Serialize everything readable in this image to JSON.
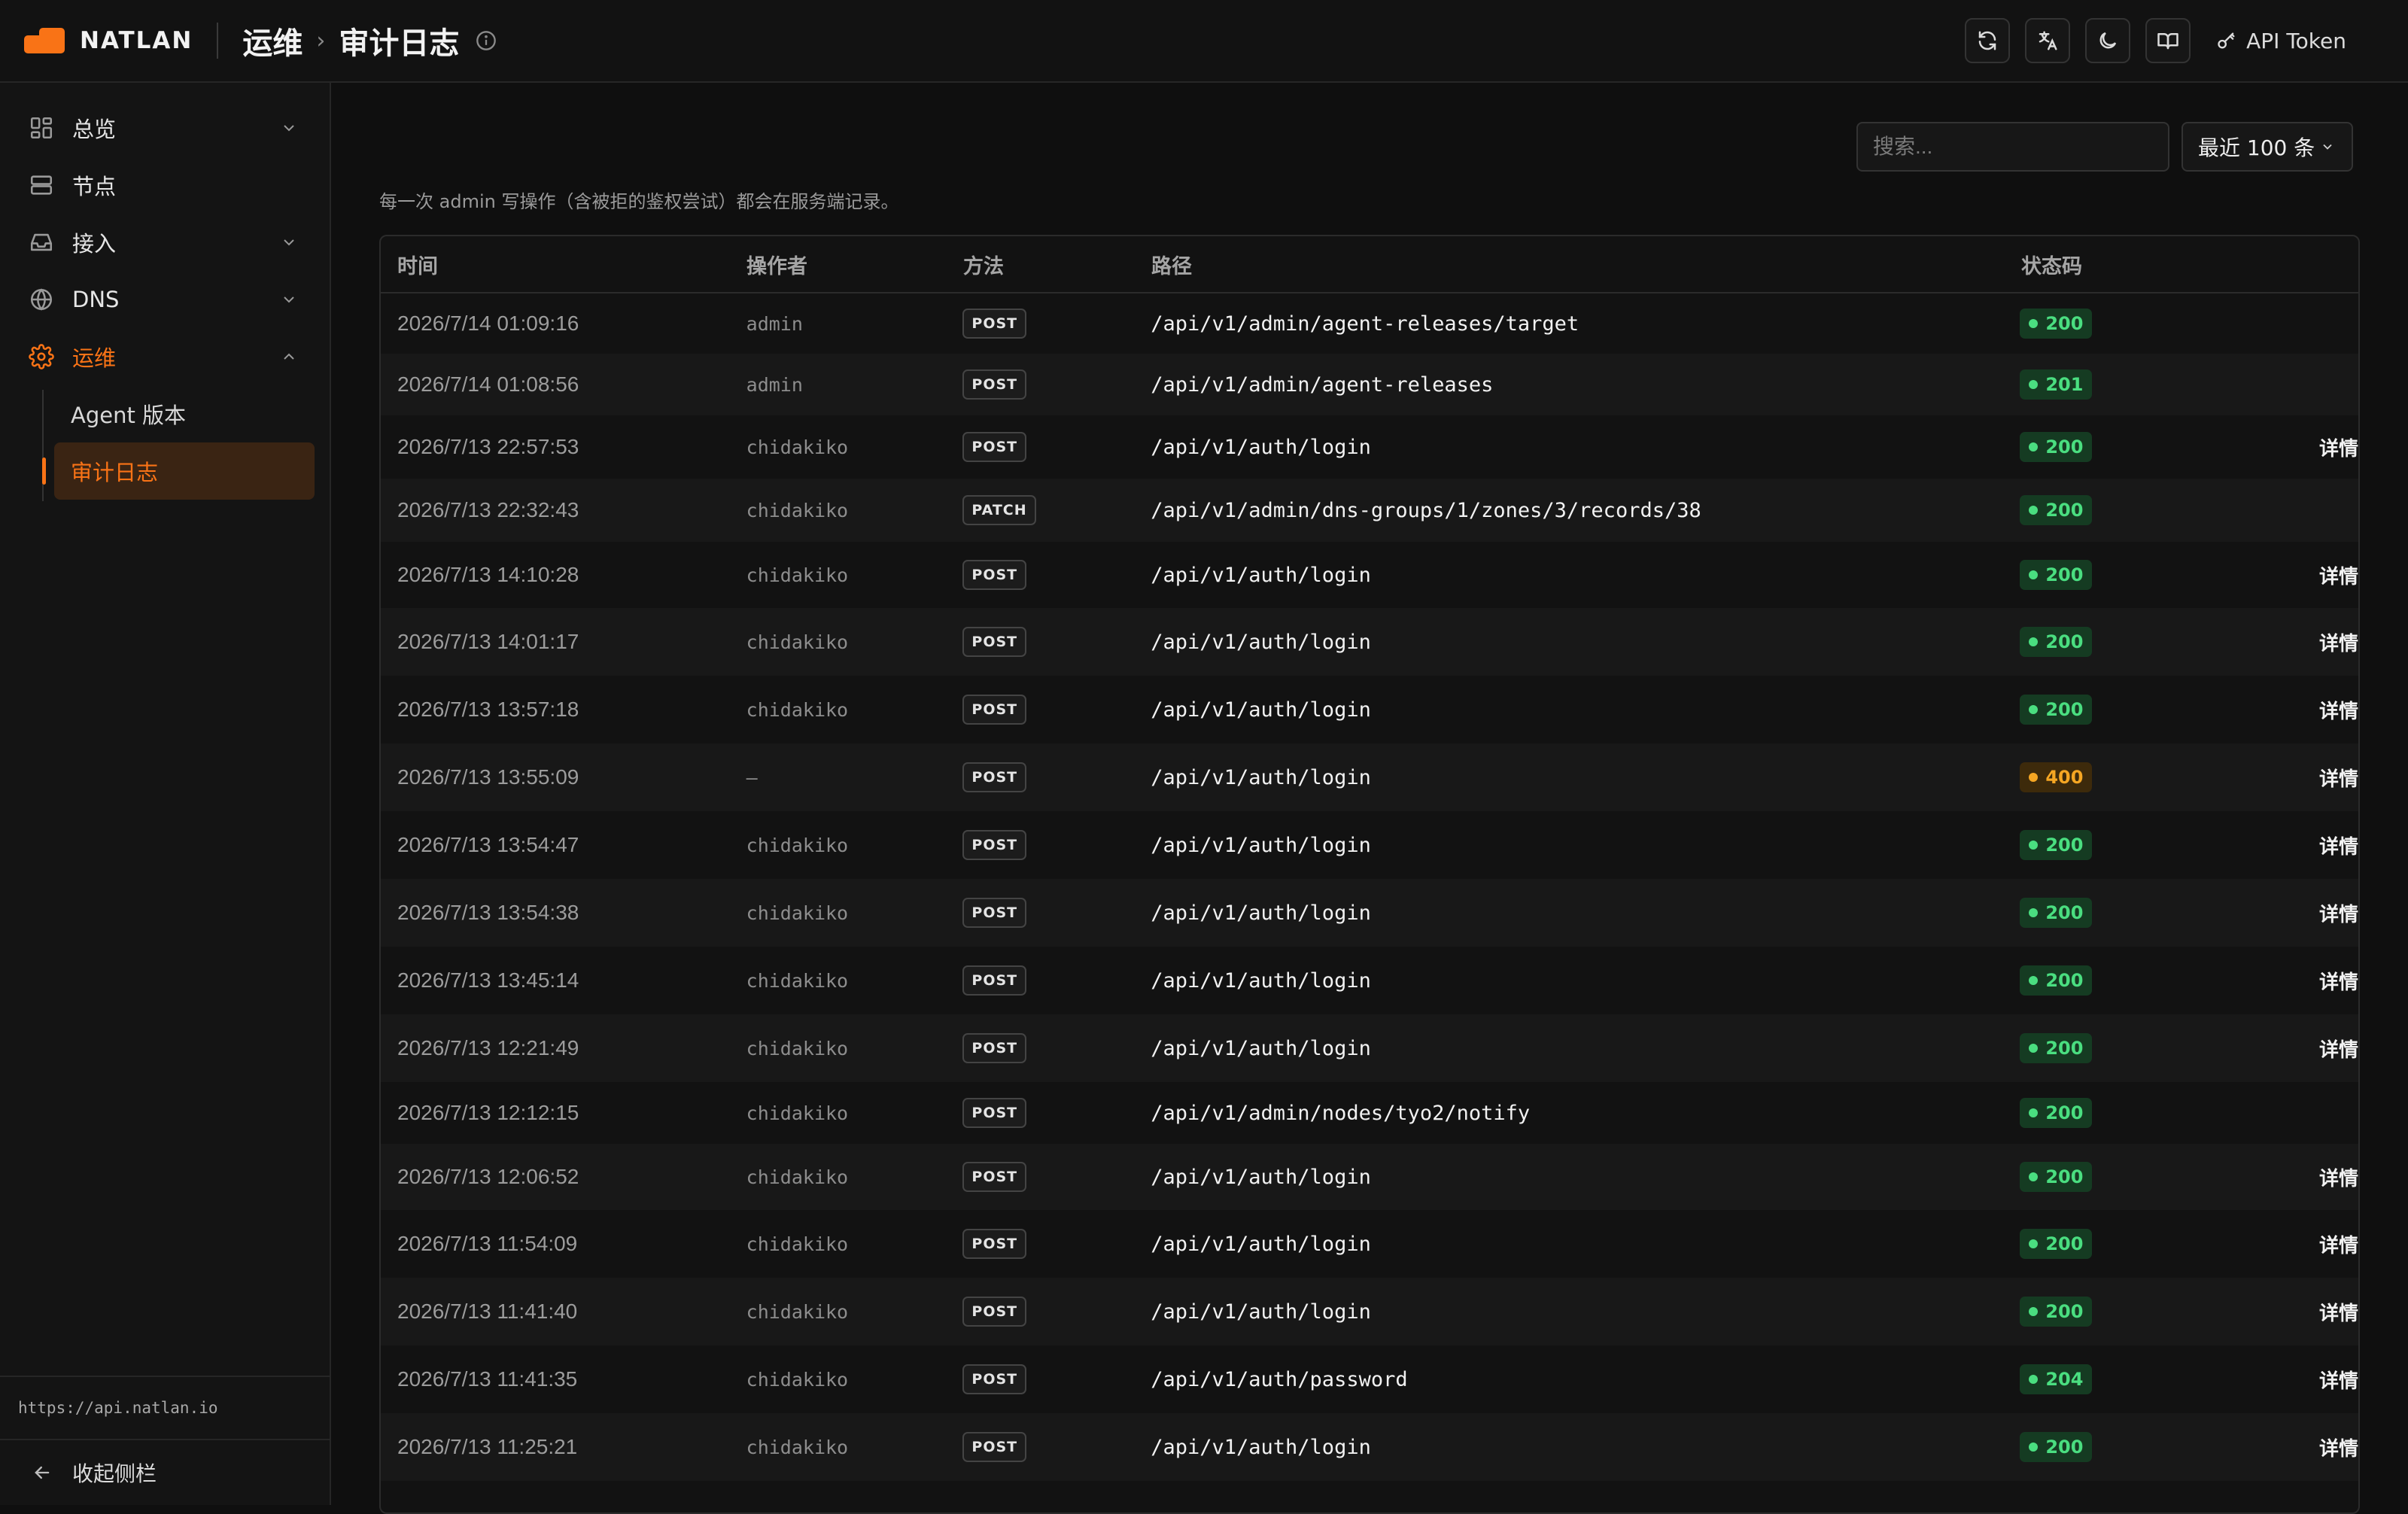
{
  "brand": {
    "name": "NATLAN"
  },
  "breadcrumb": {
    "section": "运维",
    "page": "审计日志"
  },
  "topbar": {
    "token_label": "API Token"
  },
  "sidebar": {
    "items": [
      {
        "label": "总览",
        "icon": "dashboard-icon",
        "expandable": true,
        "expanded": false
      },
      {
        "label": "节点",
        "icon": "server-icon",
        "expandable": false
      },
      {
        "label": "接入",
        "icon": "inbox-icon",
        "expandable": true,
        "expanded": false
      },
      {
        "label": "DNS",
        "icon": "globe-icon",
        "expandable": true,
        "expanded": false
      },
      {
        "label": "运维",
        "icon": "gear-icon",
        "expandable": true,
        "expanded": true,
        "active": true
      }
    ],
    "sub_items": [
      {
        "label": "Agent 版本"
      },
      {
        "label": "审计日志",
        "active": true
      }
    ],
    "api_url": "https://api.natlan.io",
    "collapse_label": "收起侧栏"
  },
  "controls": {
    "search_placeholder": "搜索...",
    "range_label": "最近 100 条"
  },
  "description": "每一次 admin 写操作（含被拒的鉴权尝试）都会在服务端记录。",
  "table": {
    "headers": {
      "time": "时间",
      "operator": "操作者",
      "method": "方法",
      "path": "路径",
      "status": "状态码"
    },
    "detail_label": "详情",
    "rows": [
      {
        "time": "2026/7/14 01:09:16",
        "operator": "admin",
        "method": "POST",
        "path": "/api/v1/admin/agent-releases/target",
        "status": "200",
        "level": "ok",
        "detail": ""
      },
      {
        "time": "2026/7/14 01:08:56",
        "operator": "admin",
        "method": "POST",
        "path": "/api/v1/admin/agent-releases",
        "status": "201",
        "level": "ok",
        "detail": ""
      },
      {
        "time": "2026/7/13 22:57:53",
        "operator": "chidakiko",
        "method": "POST",
        "path": "/api/v1/auth/login",
        "status": "200",
        "level": "ok",
        "detail": "详情"
      },
      {
        "time": "2026/7/13 22:32:43",
        "operator": "chidakiko",
        "method": "PATCH",
        "path": "/api/v1/admin/dns-groups/1/zones/3/records/38",
        "status": "200",
        "level": "ok",
        "detail": ""
      },
      {
        "time": "2026/7/13 14:10:28",
        "operator": "chidakiko",
        "method": "POST",
        "path": "/api/v1/auth/login",
        "status": "200",
        "level": "ok",
        "detail": "详情"
      },
      {
        "time": "2026/7/13 14:01:17",
        "operator": "chidakiko",
        "method": "POST",
        "path": "/api/v1/auth/login",
        "status": "200",
        "level": "ok",
        "detail": "详情"
      },
      {
        "time": "2026/7/13 13:57:18",
        "operator": "chidakiko",
        "method": "POST",
        "path": "/api/v1/auth/login",
        "status": "200",
        "level": "ok",
        "detail": "详情"
      },
      {
        "time": "2026/7/13 13:55:09",
        "operator": "—",
        "method": "POST",
        "path": "/api/v1/auth/login",
        "status": "400",
        "level": "warn",
        "detail": "详情"
      },
      {
        "time": "2026/7/13 13:54:47",
        "operator": "chidakiko",
        "method": "POST",
        "path": "/api/v1/auth/login",
        "status": "200",
        "level": "ok",
        "detail": "详情"
      },
      {
        "time": "2026/7/13 13:54:38",
        "operator": "chidakiko",
        "method": "POST",
        "path": "/api/v1/auth/login",
        "status": "200",
        "level": "ok",
        "detail": "详情"
      },
      {
        "time": "2026/7/13 13:45:14",
        "operator": "chidakiko",
        "method": "POST",
        "path": "/api/v1/auth/login",
        "status": "200",
        "level": "ok",
        "detail": "详情"
      },
      {
        "time": "2026/7/13 12:21:49",
        "operator": "chidakiko",
        "method": "POST",
        "path": "/api/v1/auth/login",
        "status": "200",
        "level": "ok",
        "detail": "详情"
      },
      {
        "time": "2026/7/13 12:12:15",
        "operator": "chidakiko",
        "method": "POST",
        "path": "/api/v1/admin/nodes/tyo2/notify",
        "status": "200",
        "level": "ok",
        "detail": ""
      },
      {
        "time": "2026/7/13 12:06:52",
        "operator": "chidakiko",
        "method": "POST",
        "path": "/api/v1/auth/login",
        "status": "200",
        "level": "ok",
        "detail": "详情"
      },
      {
        "time": "2026/7/13 11:54:09",
        "operator": "chidakiko",
        "method": "POST",
        "path": "/api/v1/auth/login",
        "status": "200",
        "level": "ok",
        "detail": "详情"
      },
      {
        "time": "2026/7/13 11:41:40",
        "operator": "chidakiko",
        "method": "POST",
        "path": "/api/v1/auth/login",
        "status": "200",
        "level": "ok",
        "detail": "详情"
      },
      {
        "time": "2026/7/13 11:41:35",
        "operator": "chidakiko",
        "method": "POST",
        "path": "/api/v1/auth/password",
        "status": "204",
        "level": "ok",
        "detail": "详情"
      },
      {
        "time": "2026/7/13 11:25:21",
        "operator": "chidakiko",
        "method": "POST",
        "path": "/api/v1/auth/login",
        "status": "200",
        "level": "ok",
        "detail": "详情"
      }
    ]
  },
  "colors": {
    "accent": "#f97316",
    "ok": "#4ade80",
    "warn": "#f5a623",
    "background": "#0f0f0f"
  }
}
